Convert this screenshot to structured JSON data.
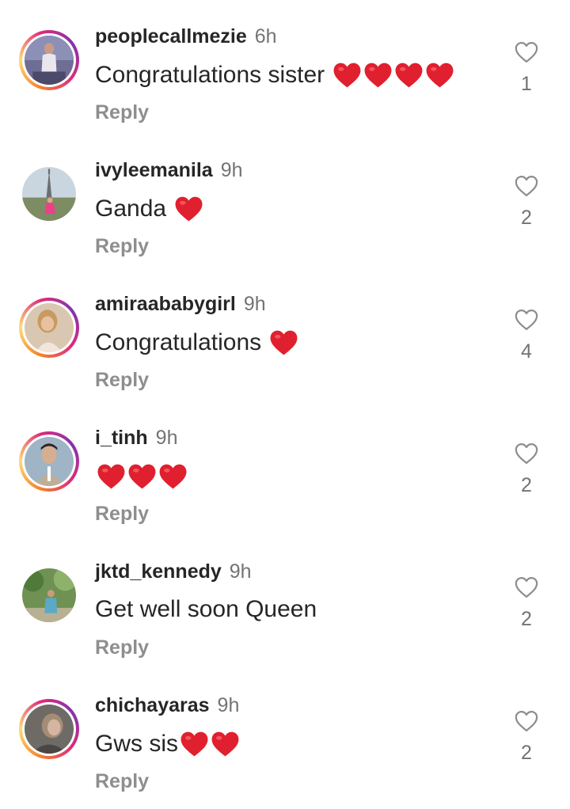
{
  "comments": [
    {
      "username": "peoplecallmezie",
      "time": "6h",
      "text": "Congratulations sister",
      "hearts": 4,
      "reply_label": "Reply",
      "likes": "1",
      "story_ring": true
    },
    {
      "username": "ivyleemanila",
      "time": "9h",
      "text": "Ganda",
      "hearts": 1,
      "reply_label": "Reply",
      "likes": "2",
      "story_ring": false
    },
    {
      "username": "amiraababygirl",
      "time": "9h",
      "text": "Congratulations",
      "hearts": 1,
      "reply_label": "Reply",
      "likes": "4",
      "story_ring": true
    },
    {
      "username": "i_tinh",
      "time": "9h",
      "text": "",
      "hearts": 3,
      "reply_label": "Reply",
      "likes": "2",
      "story_ring": true
    },
    {
      "username": "jktd_kennedy",
      "time": "9h",
      "text": "Get well soon Queen",
      "hearts": 0,
      "reply_label": "Reply",
      "likes": "2",
      "story_ring": false
    },
    {
      "username": "chichayaras",
      "time": "9h",
      "text": "Gws sis",
      "hearts": 2,
      "reply_label": "Reply",
      "likes": "2",
      "story_ring": true
    }
  ],
  "colors": {
    "heart_emoji": "#e0202e",
    "username": "#262626",
    "muted": "#737373",
    "reply": "#8e8e8e"
  },
  "icons": {
    "heart_emoji": "red-heart-emoji",
    "like": "heart-outline-icon"
  }
}
